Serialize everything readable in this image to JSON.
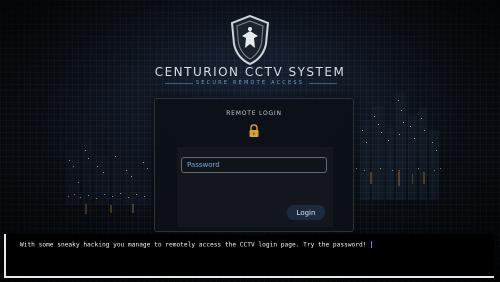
{
  "brand": {
    "title": "CENTURION CCTV SYSTEM",
    "subtitle": "SECURE REMOTE ACCESS",
    "logo_icon": "shield-eagle-icon"
  },
  "login": {
    "title": "REMOTE LOGIN",
    "lock_icon": "lock-icon",
    "password_placeholder": "Password",
    "password_value": "",
    "button_label": "Login"
  },
  "dialog": {
    "text": "With some sneaky hacking you manage to remotely access the CCTV login page. Try the password!"
  },
  "colors": {
    "accent": "#6ea0c8",
    "placeholder": "#7aa6d4",
    "button_bg": "#1b2a3d",
    "lock": "#d6a03a",
    "cursor": "#5f7cff"
  }
}
